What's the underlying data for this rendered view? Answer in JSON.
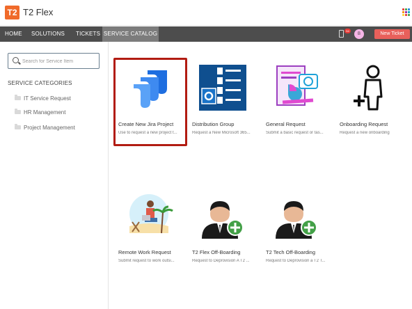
{
  "app": {
    "logo": "T2",
    "title": "T2 Flex"
  },
  "nav": {
    "items": [
      "HOME",
      "SOLUTIONS",
      "TICKETS",
      "SERVICE CATALOG"
    ],
    "active_index": 3,
    "notification_count": "54",
    "avatar_initial": "B",
    "new_ticket_label": "New Ticket"
  },
  "search": {
    "placeholder": "Search for Service Item"
  },
  "sidebar": {
    "heading": "SERVICE CATEGORIES",
    "categories": [
      "IT Service Request",
      "HR Management",
      "Project Management"
    ]
  },
  "catalog": [
    {
      "title": "Create New Jira Project",
      "desc": "Use to request a new project t...",
      "icon": "jira-logo-icon",
      "selected": true
    },
    {
      "title": "Distribution Group",
      "desc": "Request a New Microsoft 365...",
      "icon": "outlook-contacts-icon"
    },
    {
      "title": "General Request",
      "desc": "Submit a basic request or tas...",
      "icon": "general-request-icon"
    },
    {
      "title": "Onboarding Request",
      "desc": "Request a new onboarding",
      "icon": "person-add-outline-icon"
    },
    {
      "title": "Remote Work Request",
      "desc": "Submit request to work outsi...",
      "icon": "remote-work-beach-icon"
    },
    {
      "title": "T2 Flex Off-Boarding",
      "desc": "Request to Deprovision A T2 ...",
      "icon": "businessman-add-icon"
    },
    {
      "title": "T2 Tech Off-Boarding",
      "desc": "Request to Deprovision a T2 T...",
      "icon": "businessman-add-icon"
    }
  ],
  "colors": {
    "accent": "#f06a2a",
    "nav_bg": "#4d4d4d",
    "nav_active": "#7c7c7c",
    "new_ticket": "#e8605b",
    "selected_border": "#b21c12"
  }
}
